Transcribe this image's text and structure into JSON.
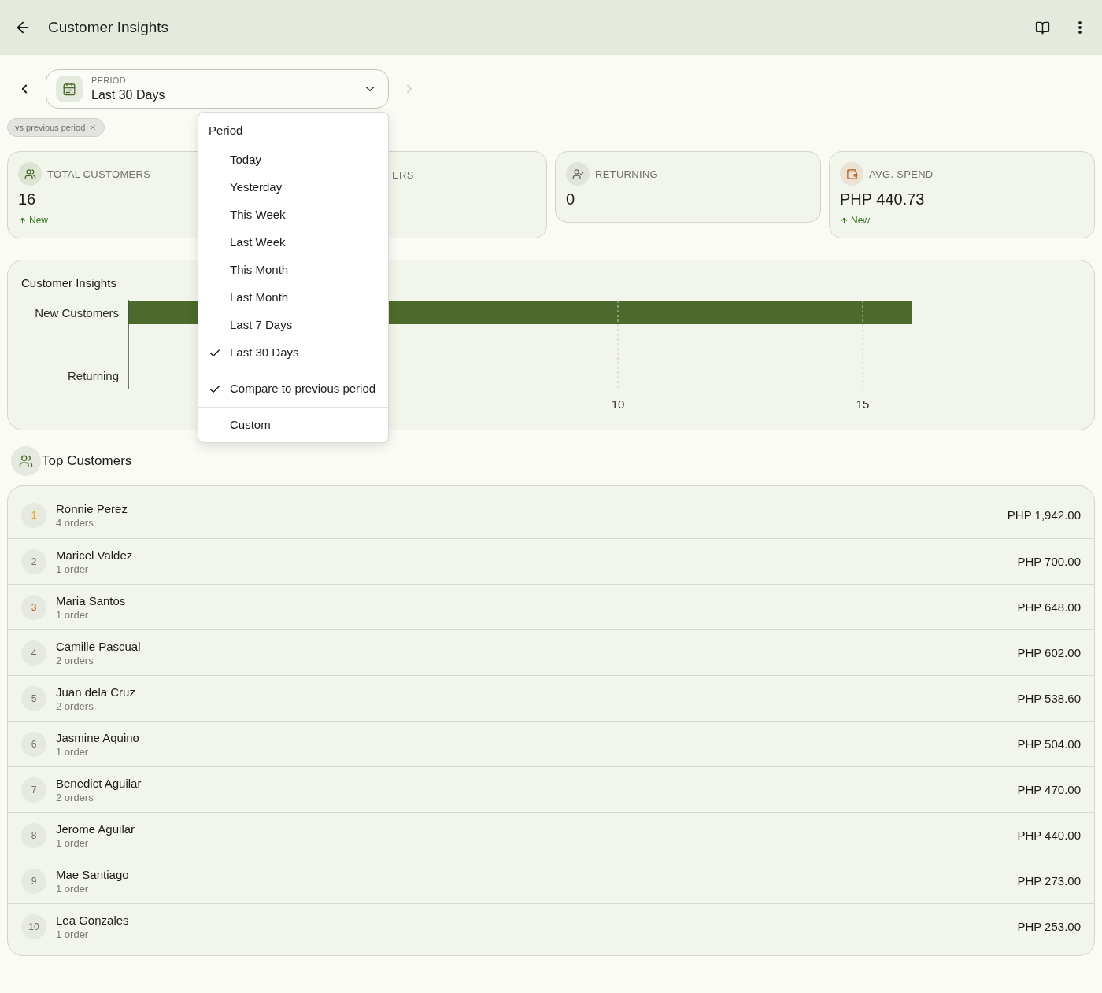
{
  "app_bar": {
    "title": "Customer Insights"
  },
  "period_nav": {
    "previous": {
      "disabled": false
    },
    "next": {
      "disabled": true
    },
    "select": {
      "label": "PERIOD",
      "value": "Last 30 Days",
      "expanded": true
    }
  },
  "period_menu": {
    "title": "Period",
    "options": [
      {
        "label": "Today",
        "selected": false
      },
      {
        "label": "Yesterday",
        "selected": false
      },
      {
        "label": "This Week",
        "selected": false
      },
      {
        "label": "Last Week",
        "selected": false
      },
      {
        "label": "This Month",
        "selected": false
      },
      {
        "label": "Last Month",
        "selected": false
      },
      {
        "label": "Last 7 Days",
        "selected": false
      },
      {
        "label": "Last 30 Days",
        "selected": true
      }
    ],
    "compare": {
      "label": "Compare to previous period",
      "checked": true
    },
    "custom": {
      "label": "Custom"
    }
  },
  "comparison_chip": {
    "label": "vs previous period"
  },
  "stats": [
    {
      "kind": "metric",
      "label": "TOTAL CUSTOMERS",
      "value": "16",
      "trend": "New",
      "color": "#4d6a2c"
    },
    {
      "kind": "covered",
      "label": "ERS"
    },
    {
      "kind": "metric",
      "label": "RETURNING",
      "value": "0",
      "color": "#6b6c67"
    },
    {
      "kind": "metric",
      "label": "AVG. SPEND",
      "value": "PHP 440.73",
      "trend": "New",
      "color": "#b85a1b"
    }
  ],
  "chart": {
    "title": "Customer Insights",
    "chart_data": {
      "type": "bar",
      "orientation": "horizontal",
      "categories": [
        "New Customers",
        "Returning"
      ],
      "values": [
        16,
        0
      ],
      "xlim": [
        0,
        16
      ],
      "xticks": [
        10,
        15
      ]
    }
  },
  "top_customers": {
    "title": "Top Customers",
    "rows": [
      {
        "rank": "1",
        "name": "Ronnie Perez",
        "orders": "4 orders",
        "amount": "PHP 1,942.00",
        "color": "#e2a516"
      },
      {
        "rank": "2",
        "name": "Maricel Valdez",
        "orders": "1 order",
        "amount": "PHP 700.00",
        "color": "#6f706b"
      },
      {
        "rank": "3",
        "name": "Maria Santos",
        "orders": "1 order",
        "amount": "PHP 648.00",
        "color": "#c0601c"
      },
      {
        "rank": "4",
        "name": "Camille Pascual",
        "orders": "2 orders",
        "amount": "PHP 602.00",
        "color": "#6f706b"
      },
      {
        "rank": "5",
        "name": "Juan dela Cruz",
        "orders": "2 orders",
        "amount": "PHP 538.60",
        "color": "#6f706b"
      },
      {
        "rank": "6",
        "name": "Jasmine Aquino",
        "orders": "1 order",
        "amount": "PHP 504.00",
        "color": "#6f706b"
      },
      {
        "rank": "7",
        "name": "Benedict Aguilar",
        "orders": "2 orders",
        "amount": "PHP 470.00",
        "color": "#6f706b"
      },
      {
        "rank": "8",
        "name": "Jerome Aguilar",
        "orders": "1 order",
        "amount": "PHP 440.00",
        "color": "#6f706b"
      },
      {
        "rank": "9",
        "name": "Mae Santiago",
        "orders": "1 order",
        "amount": "PHP 273.00",
        "color": "#6f706b"
      },
      {
        "rank": "10",
        "name": "Lea Gonzales",
        "orders": "1 order",
        "amount": "PHP 253.00",
        "color": "#6f706b"
      }
    ]
  }
}
